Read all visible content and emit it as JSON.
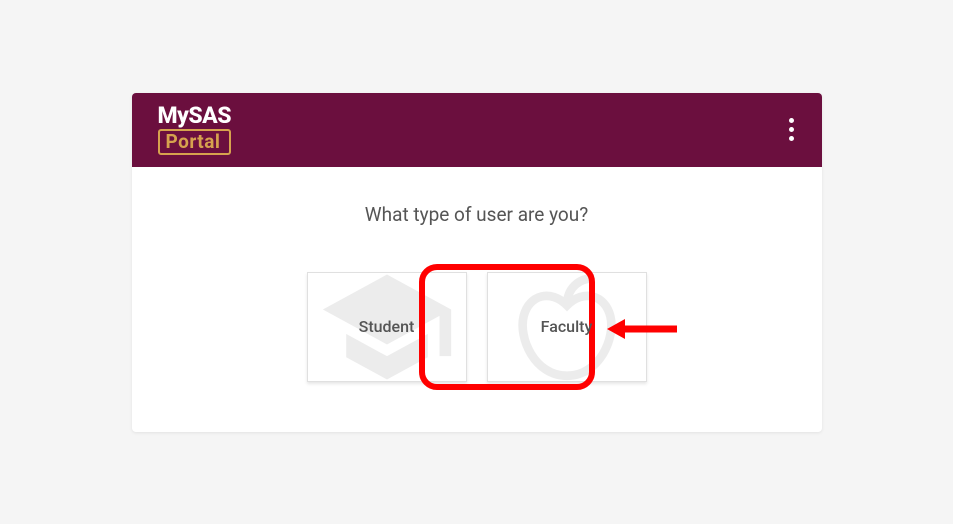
{
  "logo": {
    "top": "MySAS",
    "bottom": "Portal"
  },
  "prompt": "What type of user are you?",
  "options": {
    "student": "Student",
    "faculty": "Faculty"
  },
  "annotation": {
    "highlighted_option": "faculty"
  }
}
